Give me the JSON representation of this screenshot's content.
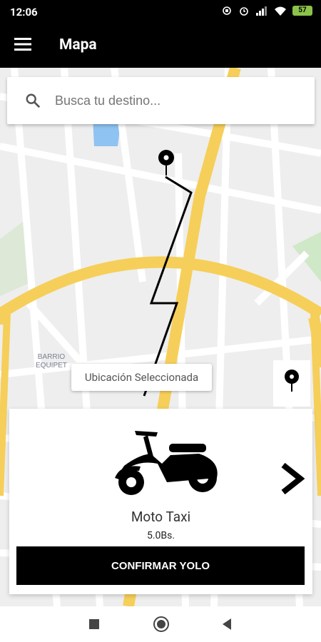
{
  "status_bar": {
    "time": "12:06",
    "battery": "57"
  },
  "app_bar": {
    "title": "Mapa"
  },
  "search": {
    "placeholder": "Busca tu destino..."
  },
  "map": {
    "district_label_line1": "BARRIO",
    "district_label_line2": "EQUIPET",
    "marker_tooltip": "Ubicación Seleccionada"
  },
  "vehicle": {
    "name": "Moto Taxi",
    "price": "5.0Bs.",
    "icon": "scooter-icon"
  },
  "actions": {
    "confirm_label": "CONFIRMAR YOLO"
  },
  "colors": {
    "road_major": "#f6cf5a",
    "road_minor": "#ffffff",
    "map_bg": "#eeeeee",
    "route": "#000000",
    "water": "#8ec3f2",
    "park": "#cfe8c8"
  }
}
